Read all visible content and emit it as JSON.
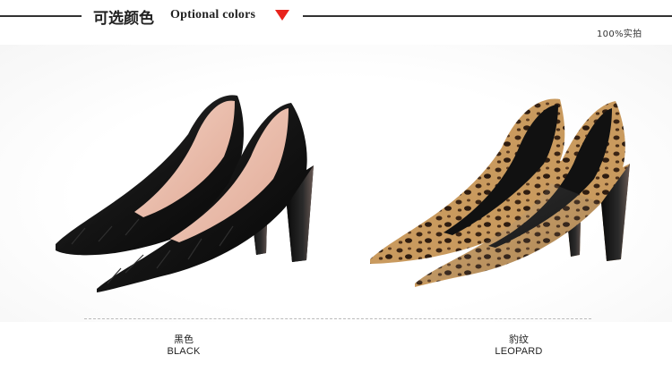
{
  "header": {
    "title_cn": "可选颜色",
    "title_en": "Optional colors",
    "real_shot": "100%实拍",
    "arrow_color": "#e8231c"
  },
  "products": [
    {
      "name_cn": "黑色",
      "name_en": "BLACK",
      "color": "#111111",
      "image": "black-pumps-image"
    },
    {
      "name_cn": "豹纹",
      "name_en": "LEOPARD",
      "color": "#b8894e",
      "image": "leopard-pumps-image"
    }
  ]
}
